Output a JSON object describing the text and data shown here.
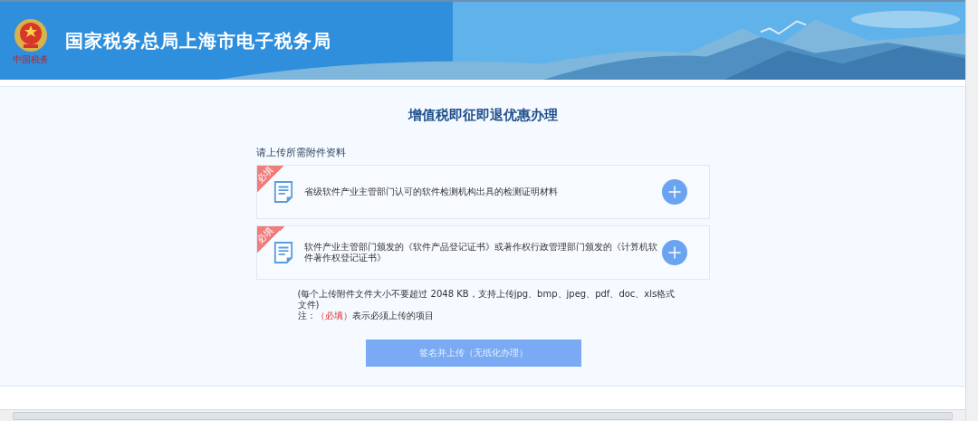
{
  "header": {
    "title": "国家税务总局上海市电子税务局",
    "emblem_caption": "中国税务"
  },
  "page_title": "增值税即征即退优惠办理",
  "upload": {
    "heading": "请上传所需附件资料",
    "items": [
      {
        "badge": "必填",
        "required": true,
        "label": "省级软件产业主管部门认可的软件检测机构出具的检测证明材料"
      },
      {
        "badge": "必填",
        "required": true,
        "label": "软件产业主管部门颁发的《软件产品登记证书》或著作权行政管理部门颁发的《计算机软件著作权登记证书》"
      }
    ]
  },
  "notes": {
    "size_hint": "(每个上传附件文件大小不要超过 2048 KB，支持上传jpg、bmp、jpeg、pdf、doc、xls格式文件)",
    "legend_prefix": "注：",
    "legend_mark": "（必填）",
    "legend_suffix": "表示必须上传的项目"
  },
  "submit_button": {
    "label": "签名并上传（无纸化办理）",
    "disabled": true
  }
}
